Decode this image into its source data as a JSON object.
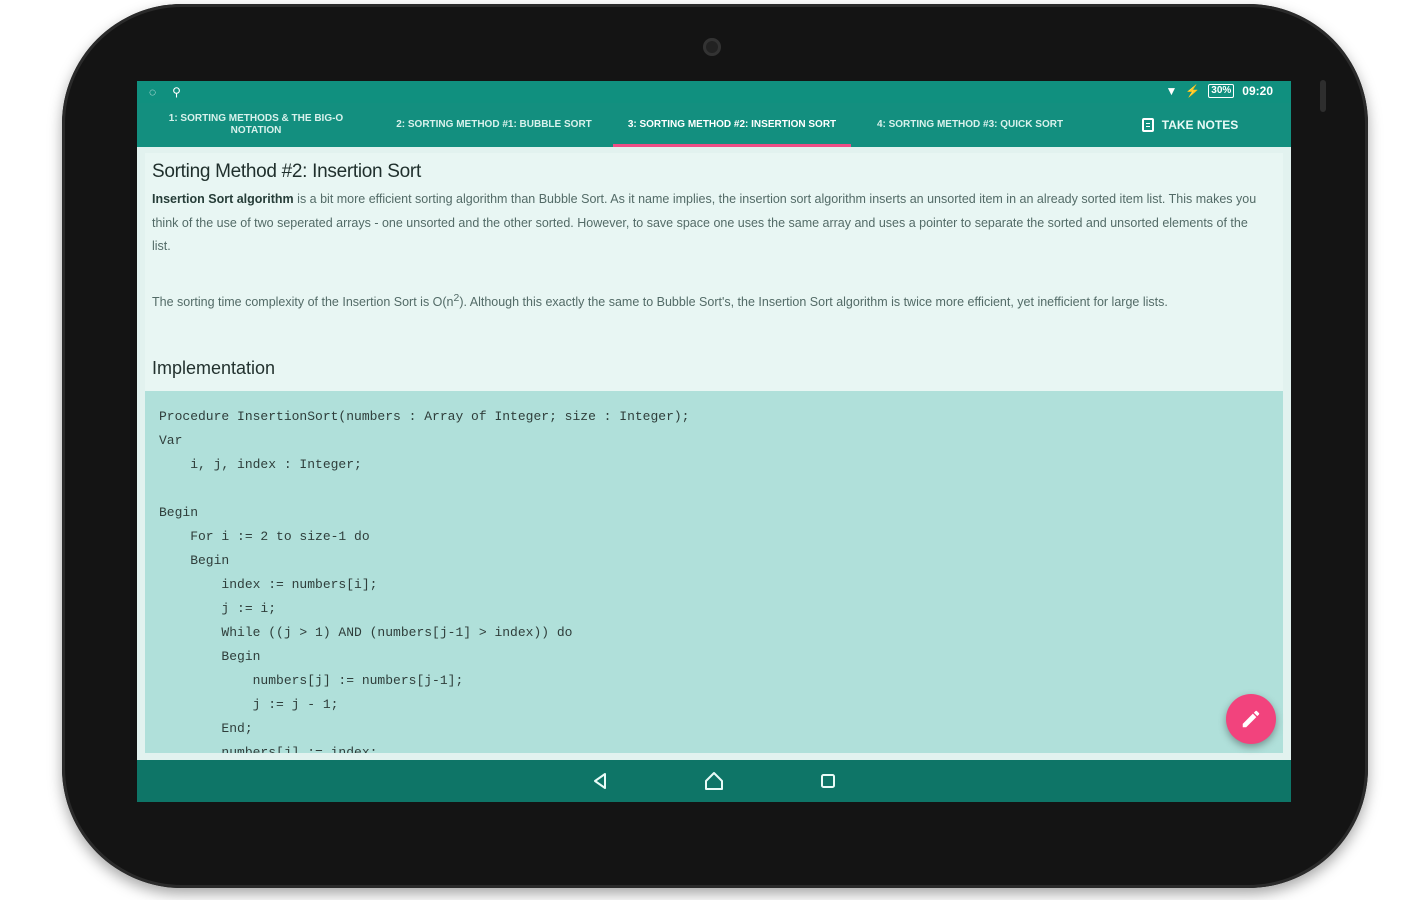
{
  "status_bar": {
    "battery": "30%",
    "time": "09:20"
  },
  "tabs": [
    {
      "label": "1: Sorting Methods & The Big-O Notation",
      "active": false
    },
    {
      "label": "2: Sorting Method #1: Bubble Sort",
      "active": false
    },
    {
      "label": "3: Sorting Method #2: Insertion Sort",
      "active": true
    },
    {
      "label": "4: Sorting Method #3: Quick Sort",
      "active": false
    }
  ],
  "take_notes_label": "Take Notes",
  "article": {
    "title": "Sorting Method #2: Insertion Sort",
    "intro_term": "Insertion Sort algorithm",
    "intro_rest": " is a bit more efficient sorting algorithm than Bubble Sort. As it name implies, the insertion sort algorithm inserts an unsorted item in an already sorted item list. This makes you think of the use of two seperated arrays - one unsorted and the other sorted. However, to save space one uses the same array and uses a pointer to separate the sorted and unsorted elements of the list.",
    "complexity_before": "The sorting time complexity of the Insertion Sort is O(n",
    "complexity_exp": "2",
    "complexity_after": "). Although this exactly the same to Bubble Sort's, the Insertion Sort algorithm is twice more efficient, yet inefficient for large lists.",
    "implementation_heading": "Implementation",
    "code": "Procedure InsertionSort(numbers : Array of Integer; size : Integer);\nVar\n    i, j, index : Integer;\n\nBegin\n    For i := 2 to size-1 do\n    Begin\n        index := numbers[i];\n        j := i;\n        While ((j > 1) AND (numbers[j-1] > index)) do\n        Begin\n            numbers[j] := numbers[j-1];\n            j := j - 1;\n        End;\n        numbers[j] := index;"
  },
  "colors": {
    "primary": "#138f7f",
    "accent": "#f2437d",
    "nav": "#0e7567"
  },
  "icons": {
    "fab": "pencil-icon",
    "back": "back-triangle-icon",
    "home": "home-icon",
    "recent": "recent-apps-icon"
  }
}
